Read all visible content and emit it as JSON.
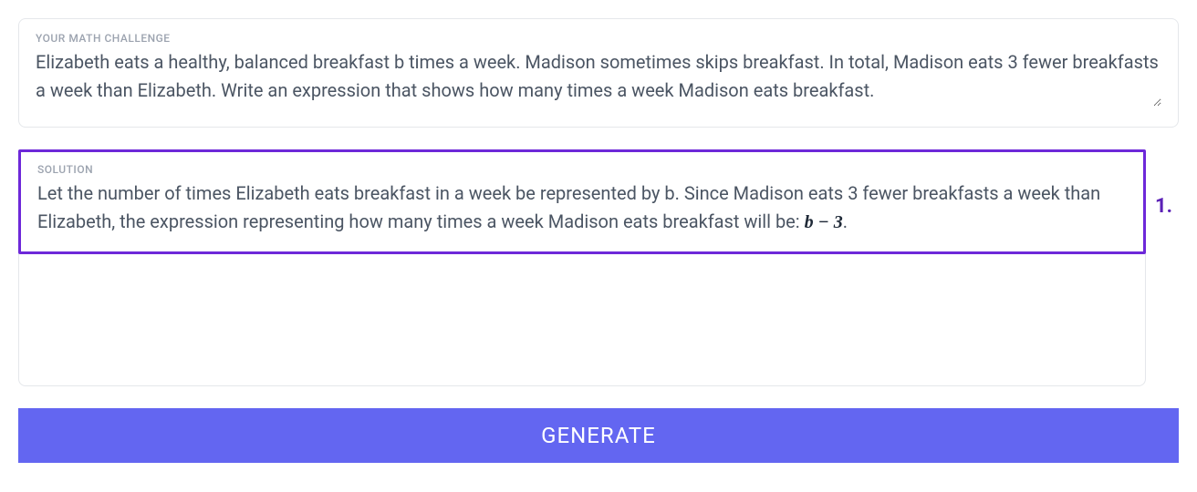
{
  "challenge": {
    "label": "YOUR MATH CHALLENGE",
    "value": "Elizabeth eats a healthy, balanced breakfast b times a week. Madison sometimes skips breakfast. In total, Madison eats 3 fewer breakfasts a week than Elizabeth. Write an expression that shows how many times a week Madison eats breakfast."
  },
  "solution": {
    "label": "SOLUTION",
    "text_part1": "Let the number of times Elizabeth eats breakfast in a week be represented by b. Since Madison eats 3 fewer breakfasts a week than Elizabeth, the expression representing how many times a week Madison eats breakfast will be: ",
    "math_expression": "b − 3",
    "text_part2": "."
  },
  "annotation": {
    "number": "1."
  },
  "actions": {
    "generate_label": "GENERATE"
  }
}
